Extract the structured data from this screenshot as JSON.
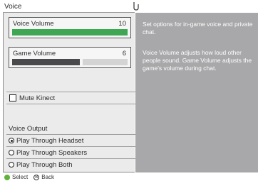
{
  "screen": {
    "title": "Voice"
  },
  "voice_volume": {
    "label": "Voice Volume",
    "value": "10",
    "level": 1.0
  },
  "game_volume": {
    "label": "Game Volume",
    "value": "6",
    "level": 0.6
  },
  "mute_kinect": {
    "label": "Mute Kinect",
    "checked": false
  },
  "voice_output": {
    "heading": "Voice Output",
    "options": [
      {
        "label": "Play Through Headset",
        "selected": true
      },
      {
        "label": "Play Through Speakers",
        "selected": false
      },
      {
        "label": "Play Through Both",
        "selected": false
      }
    ]
  },
  "help": {
    "paragraph1": "Set options for in-game voice and private chat.",
    "paragraph2": "Voice Volume adjusts how loud other people sound. Game Volume adjusts the game's volume during chat."
  },
  "footer": {
    "select_label": "Select",
    "back_label": "Back",
    "back_glyph": "B"
  },
  "colors": {
    "voice_fill": "#3fa654",
    "game_fill": "#4a4a4c",
    "right_panel": "#a8a8aa",
    "select_button": "#5fb23b"
  }
}
